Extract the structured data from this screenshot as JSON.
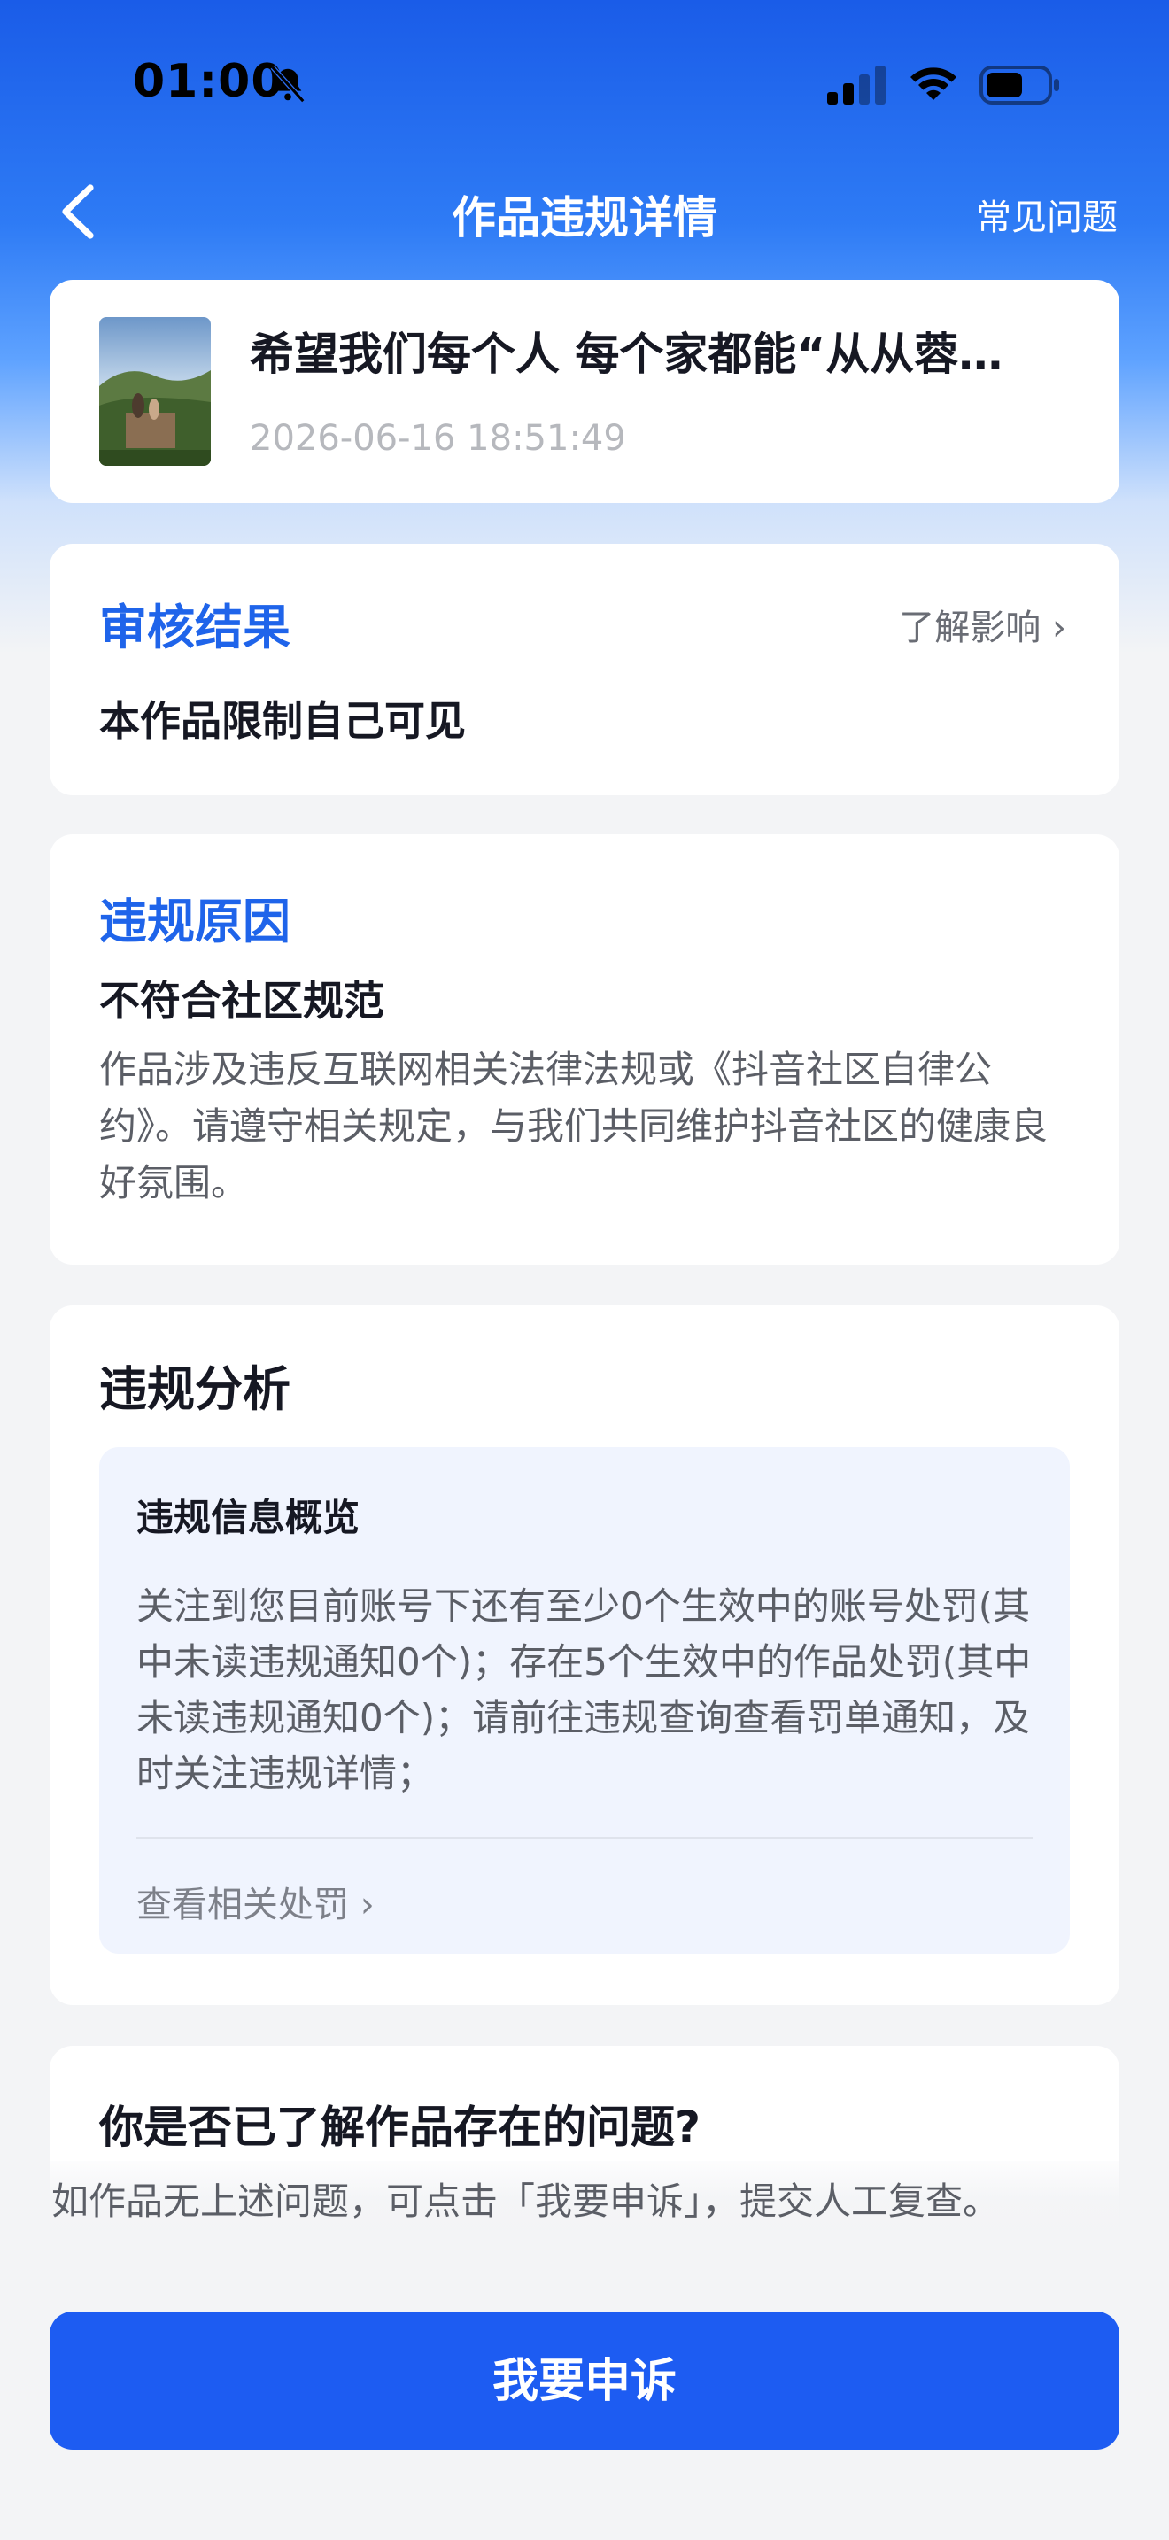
{
  "status_bar": {
    "time": "01:00",
    "icons": [
      "bell-off-icon",
      "signal-icon",
      "wifi-icon",
      "battery-icon"
    ]
  },
  "nav": {
    "back_icon": "chevron-left-icon",
    "title": "作品违规详情",
    "faq": "常见问题"
  },
  "video": {
    "title": "希望我们每个人 每个家都能“从从蓉…",
    "timestamp": "2026-06-16 18:51:49"
  },
  "review_result": {
    "title": "审核结果",
    "impact_link": "了解影响 ›",
    "text": "本作品限制自己可见"
  },
  "violation_reason": {
    "title": "违规原因",
    "subtitle": "不符合社区规范",
    "description": "作品涉及违反互联网相关法律法规或《抖音社区自律公约》。请遵守相关规定，与我们共同维护抖音社区的健康良好氛围。"
  },
  "analysis": {
    "title": "违规分析",
    "overview_title": "违规信息概览",
    "overview_text": "关注到您目前账号下还有至少0个生效中的账号处罚(其中未读违规通知0个)；存在5个生效中的作品处罚(其中未读违规通知0个)；请前往违规查询查看罚单通知，及时关注违规详情；",
    "penalty_link": "查看相关处罚 ›"
  },
  "question": {
    "title": "你是否已了解作品存在的问题?"
  },
  "appeal": {
    "hint": "如作品无上述问题，可点击「我要申诉」，提交人工复查。",
    "button": "我要申诉"
  },
  "colors": {
    "accent_blue": "#1f64ea",
    "button_blue": "#1d5cf2",
    "header_gradient_top": "#1a5ce8",
    "page_background": "#f3f4f6"
  }
}
